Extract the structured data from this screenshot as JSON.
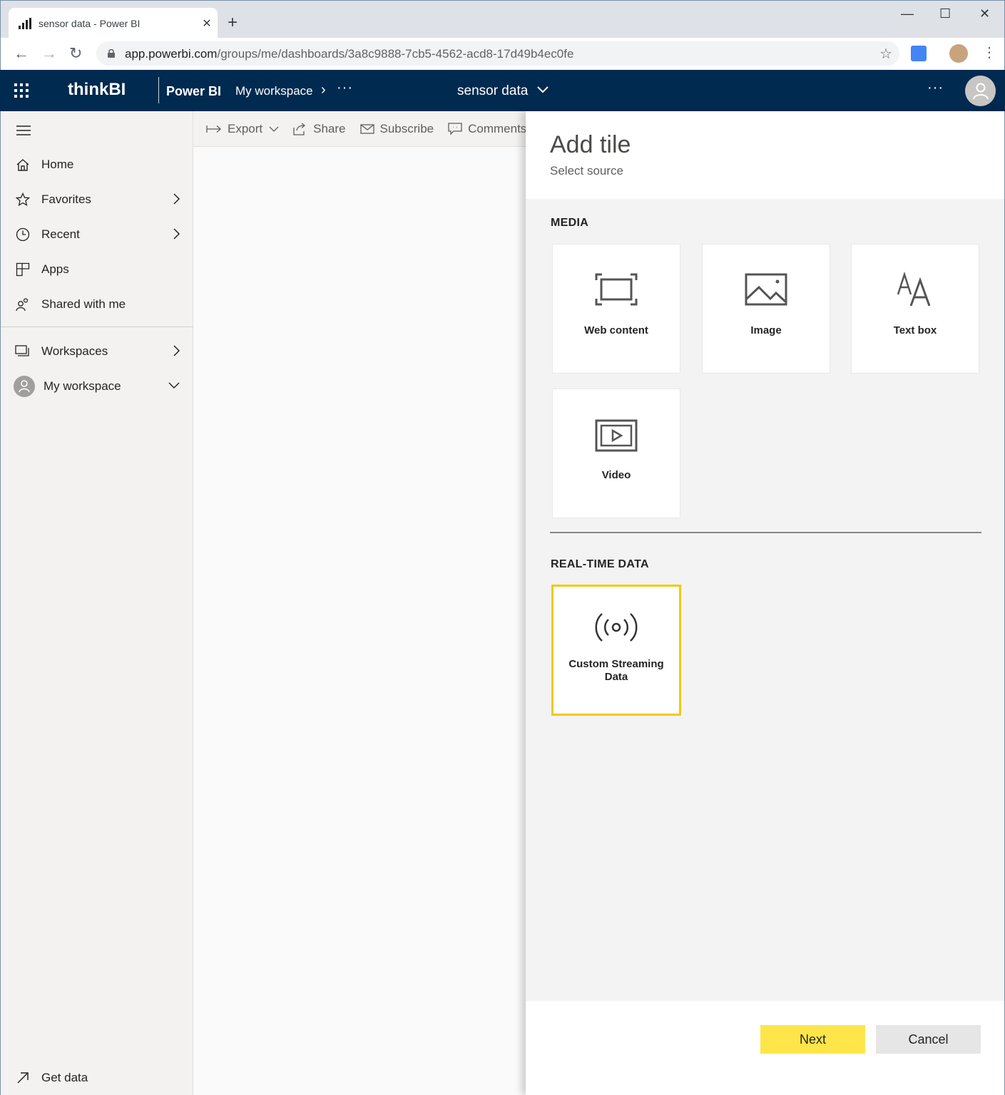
{
  "browser": {
    "tab_title": "sensor data - Power BI",
    "tab_close": "✕",
    "new_tab": "+",
    "url_host": "app.powerbi.com",
    "url_path": "/groups/me/dashboards/3a8c9888-7cb5-4562-acd8-17d49b4ec0fe",
    "minimize": "—",
    "maximize": "☐",
    "close": "✕"
  },
  "header": {
    "brand": "thinkBI",
    "product": "Power BI",
    "breadcrumb": "My workspace",
    "more": "···",
    "dashboard_title": "sensor data",
    "app_more": "···"
  },
  "sidebar": {
    "items": [
      {
        "label": "Home"
      },
      {
        "label": "Favorites"
      },
      {
        "label": "Recent"
      },
      {
        "label": "Apps"
      },
      {
        "label": "Shared with me"
      },
      {
        "label": "Workspaces"
      },
      {
        "label": "My workspace"
      }
    ],
    "get_data": "Get data"
  },
  "toolbar": {
    "export": "Export",
    "share": "Share",
    "subscribe": "Subscribe",
    "comments": "Comments"
  },
  "panel": {
    "title": "Add tile",
    "subtitle": "Select source",
    "media_heading": "MEDIA",
    "realtime_heading": "REAL-TIME DATA",
    "tiles": {
      "web": "Web content",
      "image": "Image",
      "text": "Text box",
      "video": "Video",
      "streaming_line1": "Custom Streaming",
      "streaming_line2": "Data"
    },
    "next": "Next",
    "cancel": "Cancel"
  },
  "colors": {
    "header_bg": "#002a50",
    "accent_yellow": "#f2c811",
    "next_button": "#fde54a"
  }
}
